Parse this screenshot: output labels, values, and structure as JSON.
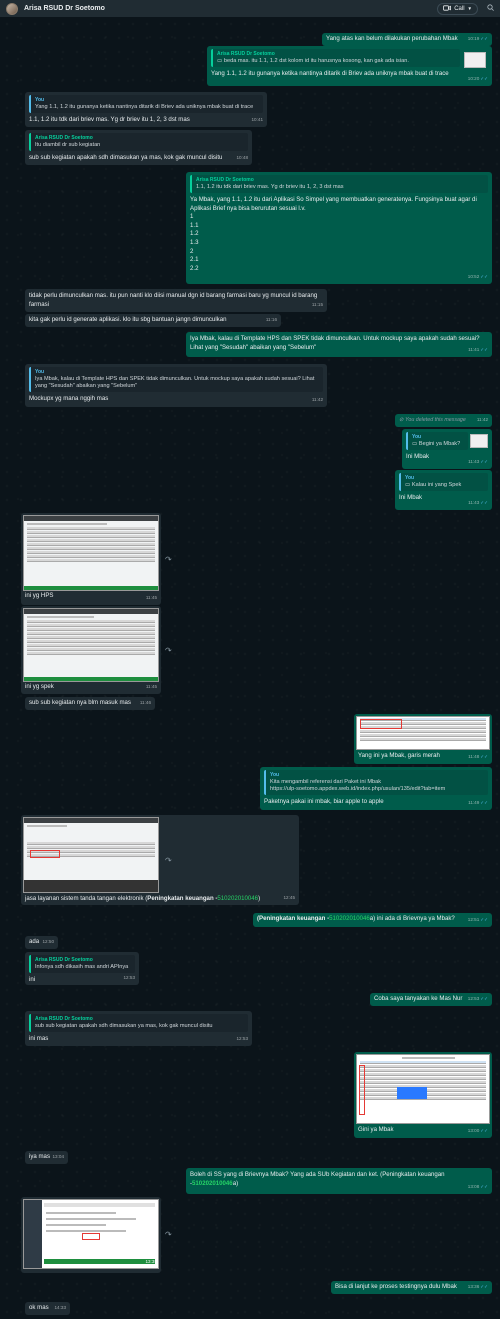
{
  "header": {
    "contact_name": "Arisa RSUD Dr Soetomo",
    "call_label": "Call"
  },
  "messages": {
    "m1": {
      "text": "Yang atas kan belum dilakukan perubahan Mbak",
      "time": "10:19"
    },
    "m2": {
      "quote_name": "Arisa RSUD Dr Soetomo",
      "quote_text": "beda mas. itu 1.1, 1.2 dst kolom id itu harusnya kosong, kan gak ada isian.",
      "text": "Yang 1.1, 1.2 itu gunanya ketika nantinya ditarik di Briev ada uniknya mbak buat di trace",
      "time": "10:20"
    },
    "m3": {
      "quote_name": "You",
      "quote_text": "Yang 1.1, 1.2 itu gunanya ketika nantinya ditarik di Briev ada uniknya mbak buat di trace",
      "text": "1.1, 1.2 itu tdk dari briev mas. Yg dr briev itu 1, 2, 3 dst mas",
      "time": "10:41"
    },
    "m4": {
      "quote_name": "Arisa RSUD Dr Soetomo",
      "quote_text": "Itu diambil dr sub kegiatan",
      "text": "sub sub kegiatan apakah sdh dimasukan ya mas, kok gak muncul disitu",
      "time": "10:48"
    },
    "m5": {
      "quote_name": "Arisa RSUD Dr Soetomo",
      "quote_text": "1.1, 1.2 itu tdk dari briev mas. Yg dr briev itu 1, 2, 3 dst mas",
      "text": "Ya Mbak, yang 1.1, 1.2 itu dari Aplikasi So Simpel yang membuatkan generatenya. Fungsinya buat agar di Aplikasi Brief nya bisa berurutan sesuai l.v.",
      "list": [
        "1",
        "1.1",
        "1.2",
        "1.3",
        "2",
        "2.1",
        "2.2"
      ],
      "time": "10:52"
    },
    "m6": {
      "text": "tidak perlu dimunculkan mas. itu pun nanti klo diisi manual dgn id barang farmasi baru yg muncul id barang farmasi",
      "time": "11:15"
    },
    "m7": {
      "text": "kita gak perlu id generate aplikasi. klo itu sbg bantuan jangn dimunculkan",
      "time": "11:16"
    },
    "m8": {
      "text": "Iya Mbak, kalau di Template HPS dan SPEK tidak dimunculkan. Untuk mockup saya apakah sudah sesuai? Lihat yang \"Sesudah\" abaikan yang \"Sebelum\"",
      "time": "11:41"
    },
    "m9": {
      "quote_name": "You",
      "quote_text": "Iya Mbak, kalau di Template HPS dan SPEK tidak dimunculkan. Untuk mockup saya apakah sudah sesuai? Lihat yang \"Sesudah\" abaikan yang \"Sebelum\"",
      "text": "Mockupx yg mana nggih mas",
      "time": "11:42"
    },
    "m10": {
      "text": "You deleted this message",
      "time": "11:42"
    },
    "m11": {
      "quote_name": "You",
      "quote_text": "Begini ya Mbak?",
      "text": "Ini Mbak",
      "time": "11:43"
    },
    "m12": {
      "quote_name": "You",
      "quote_text": "Kalau ini yang Spek",
      "text": "Ini Mbak",
      "time": "11:43"
    },
    "m13": {
      "caption": "ini yg HPS",
      "time": "11:45"
    },
    "m14": {
      "caption": "ini yg spek",
      "time": "11:45"
    },
    "m15": {
      "text": "sub sub kegiatan nya blm masuk mas",
      "time": "11:46"
    },
    "m16": {
      "caption": "Yang ini ya Mbak, garis merah",
      "time": "11:48"
    },
    "m17": {
      "quote_name": "You",
      "quote_text": "Kita mengambil referensi dari Paket ini Mbak",
      "quote_url": "https://ulp-soetomo.appdex.web.id/index.php/usulan/135/edit?tab=item",
      "text": "Paketnya pakai ini mbak, biar apple to apple",
      "time": "11:49"
    },
    "m18": {
      "caption_pre": "jasa layanan sistem tanda tangan elektronik (",
      "caption_bold": "Peningkatan keuangan -",
      "caption_num": "510202010046",
      "caption_post": ")",
      "time": "12:45"
    },
    "m19": {
      "bold": "(Peningkatan keuangan -",
      "num": "510202010046",
      "post": "a) ini ada di Brievnya ya Mbak?",
      "time": "12:51"
    },
    "m20": {
      "text": "ada",
      "time": "12:50"
    },
    "m21": {
      "quote_name": "Arisa RSUD Dr Soetomo",
      "quote_text": "Infonya sdh dikasih mas andri APInya",
      "text": "ini",
      "time": "12:53"
    },
    "m22": {
      "text": "Coba saya tanyakan ke Mas Nur",
      "time": "12:53"
    },
    "m23": {
      "quote_name": "Arisa RSUD Dr Soetomo",
      "quote_text": "sub sub kegiatan apakah sdh dimasukan ya mas, kok gak muncul disitu",
      "text": "ini mas",
      "time": "12:53"
    },
    "m24": {
      "caption": "Gini ya Mbak",
      "time": "13:00"
    },
    "m25": {
      "text": "iya mas",
      "time": "13:04"
    },
    "m26": {
      "text": "Boleh di SS yang di Brievnya Mbak? Yang ada SUb Kegiatan dan ket. (Peningkatan keuangan -",
      "num": "510202010046",
      "post": "a)",
      "time": "13:08"
    },
    "m27": {
      "time": "13:35"
    },
    "m28": {
      "text": "Bisa di lanjut ke proses testingnya dulu Mbak",
      "time": "13:36"
    },
    "m29": {
      "text": "ok mas",
      "time": "14:33"
    }
  }
}
